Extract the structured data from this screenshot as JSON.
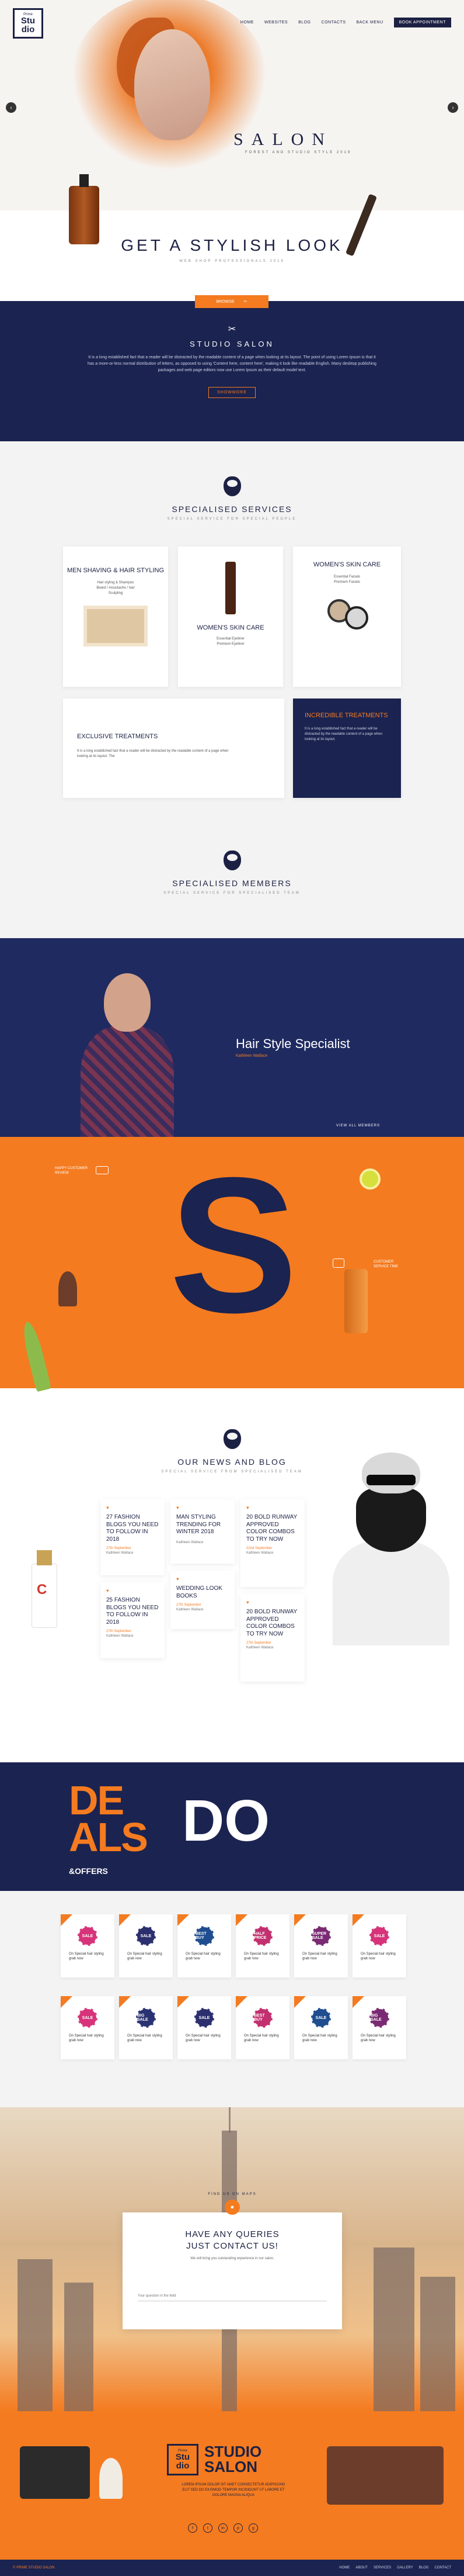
{
  "brand": {
    "small": "Prime",
    "line1": "Stu",
    "line2": "dio"
  },
  "nav": {
    "items": [
      "HOME",
      "WEBSITES",
      "BLOG",
      "CONTACTS",
      "BACK MENU"
    ],
    "cta": "BOOK APPOINTMENT"
  },
  "hero": {
    "title": "SALON",
    "subtitle": "FOREST AND STUDIO STYLE 2019",
    "prev": "‹",
    "next": "›"
  },
  "stylish": {
    "title": "GET A STYLISH LOOK",
    "subtitle": "WEB SHOP PROFESSIONALS 2019"
  },
  "studio": {
    "tab_label": "BROWSE",
    "icon": "✂",
    "title": "STUDIO SALON",
    "text": "It is a long established fact that a reader will be distracted by the readable content of a page when looking at its layout. The point of using Lorem Ipsum is that it has a more-or-less normal distribution of letters, as opposed to using 'Content here, content here', making it look like readable English. Many desktop publishing packages and web page editors now use Lorem Ipsum as their default model text.",
    "button": "SHOWMORE"
  },
  "services": {
    "title": "SPECIALISED SERVICES",
    "subtitle": "SPECIAL SERVICE FOR SPECIAL PEOPLE",
    "cards": [
      {
        "title": "MEN SHAVING & HAIR STYLING",
        "lines": [
          "Hair styling & Shampoo",
          "Beard / moustache / hair",
          "Sculpting"
        ]
      },
      {
        "title": "WOMEN'S SKIN CARE",
        "lines": [
          "Essential Eyeliner",
          "Premium Eyeliner"
        ]
      },
      {
        "title": "WOMEN'S SKIN CARE",
        "lines": [
          "Essential Facials",
          "Premium Facials"
        ]
      }
    ],
    "exclusive": {
      "title": "EXCLUSIVE TREATMENTS",
      "text": "It is a long established fact that a reader will be distracted by the readable content of a page when looking at its layout. The"
    },
    "incredible": {
      "title": "INCREDIBLE TREATMENTS",
      "text": "It is a long established fact that a reader will be distracted by the readable content of a page when looking at its layout."
    }
  },
  "members": {
    "title": "SPECIALISED MEMBERS",
    "subtitle": "SPECIAL SERVICE FOR SPECIALISED TEAM",
    "name": "Hair Style Specialist",
    "role": "Kathleen Wallace",
    "pager": "VIEW ALL MEMBERS"
  },
  "bigS": {
    "letter": "S",
    "tag_left": "HAPPY CUSTOMER\nREVIEW",
    "tag_right": "CUSTOMER\nSERVICE TIME"
  },
  "news": {
    "title": "OUR NEWS AND BLOG",
    "subtitle": "SPECIAL SERVICE FROM SPECIALISED TEAM",
    "posts": [
      {
        "title": "27 FASHION BLOGS YOU NEED TO FOLLOW IN 2018",
        "date": "27th September",
        "author": "Kathleen Wallace"
      },
      {
        "title": "MAN STYLING TRENDING FOR WINTER 2018",
        "date": "Kathleen Wallace",
        "author": ""
      },
      {
        "title": "20 BOLD RUNWAY APPROVED COLOR COMBOS TO TRY NOW",
        "date": "22nd September",
        "author": "Kathleen Wallace"
      },
      {
        "title": "25 FASHION BLOGS YOU NEED TO FOLLOW IN 2018",
        "date": "27th September",
        "author": "Kathleen Wallace"
      },
      {
        "title": "WEDDING LOOK BOOKS",
        "date": "27th September",
        "author": "Kathleen Wallace"
      },
      {
        "title": "20 BOLD RUNWAY APPROVED COLOR COMBOS TO TRY NOW",
        "date": "27th September",
        "author": "Kathleen Wallace"
      }
    ],
    "bottle_letter": "C"
  },
  "deals": {
    "de": "DE",
    "als": "ALS",
    "do": "DO",
    "offers": "&OFFERS"
  },
  "offers": {
    "items": [
      {
        "badge": "SALE",
        "color": "#d6337a",
        "text": "On Special hair styling grab now"
      },
      {
        "badge": "SALE",
        "color": "#2c2f6e",
        "text": "On Special hair styling grab now"
      },
      {
        "badge": "BEST BUY",
        "color": "#1f4d8f",
        "text": "On Special hair styling grab now"
      },
      {
        "badge": "HALF PRICE",
        "color": "#c2306f",
        "text": "On Special hair styling grab now"
      },
      {
        "badge": "SUPER SALE",
        "color": "#7a2a72",
        "text": "On Special hair styling grab now"
      },
      {
        "badge": "SALE",
        "color": "#d6337a",
        "text": "On Special hair styling grab now"
      },
      {
        "badge": "SALE",
        "color": "#d6337a",
        "text": "On Special hair styling grab now"
      },
      {
        "badge": "BIG SALE",
        "color": "#2a3372",
        "text": "On Special hair styling grab now"
      },
      {
        "badge": "SALE",
        "color": "#2c2f6e",
        "text": "On Special hair styling grab now"
      },
      {
        "badge": "BEST BUY",
        "color": "#c2306f",
        "text": "On Special hair styling grab now"
      },
      {
        "badge": "SALE",
        "color": "#1f4d8f",
        "text": "On Special hair styling grab now"
      },
      {
        "badge": "BIG SALE",
        "color": "#7a2a72",
        "text": "On Special hair styling grab now"
      }
    ]
  },
  "contact": {
    "label": "FIND US ON MAPS",
    "title_line1": "HAVE ANY QUERIES",
    "title_line2": "JUST CONTACT US!",
    "text": "We will bring you outstanding experience in our salon.",
    "field_placeholder": "Your question in the field"
  },
  "footer": {
    "name_line1": "STUDIO",
    "name_line2": "SALON",
    "info": "LOREM IPSUM DOLOR SIT AMET CONSECTETUR ADIPISCING ELIT SED DO EIUSMOD TEMPOR INCIDIDUNT UT LABORE ET DOLORE MAGNA ALIQUA",
    "socials": [
      "f",
      "t",
      "in",
      "p",
      "g"
    ],
    "copyright": "© PRIME STUDIO SALON",
    "links": [
      "HOME",
      "ABOUT",
      "SERVICES",
      "GALLERY",
      "BLOG",
      "CONTACT"
    ]
  },
  "colors": {
    "accent": "#f47b20",
    "navy": "#1b2350"
  }
}
